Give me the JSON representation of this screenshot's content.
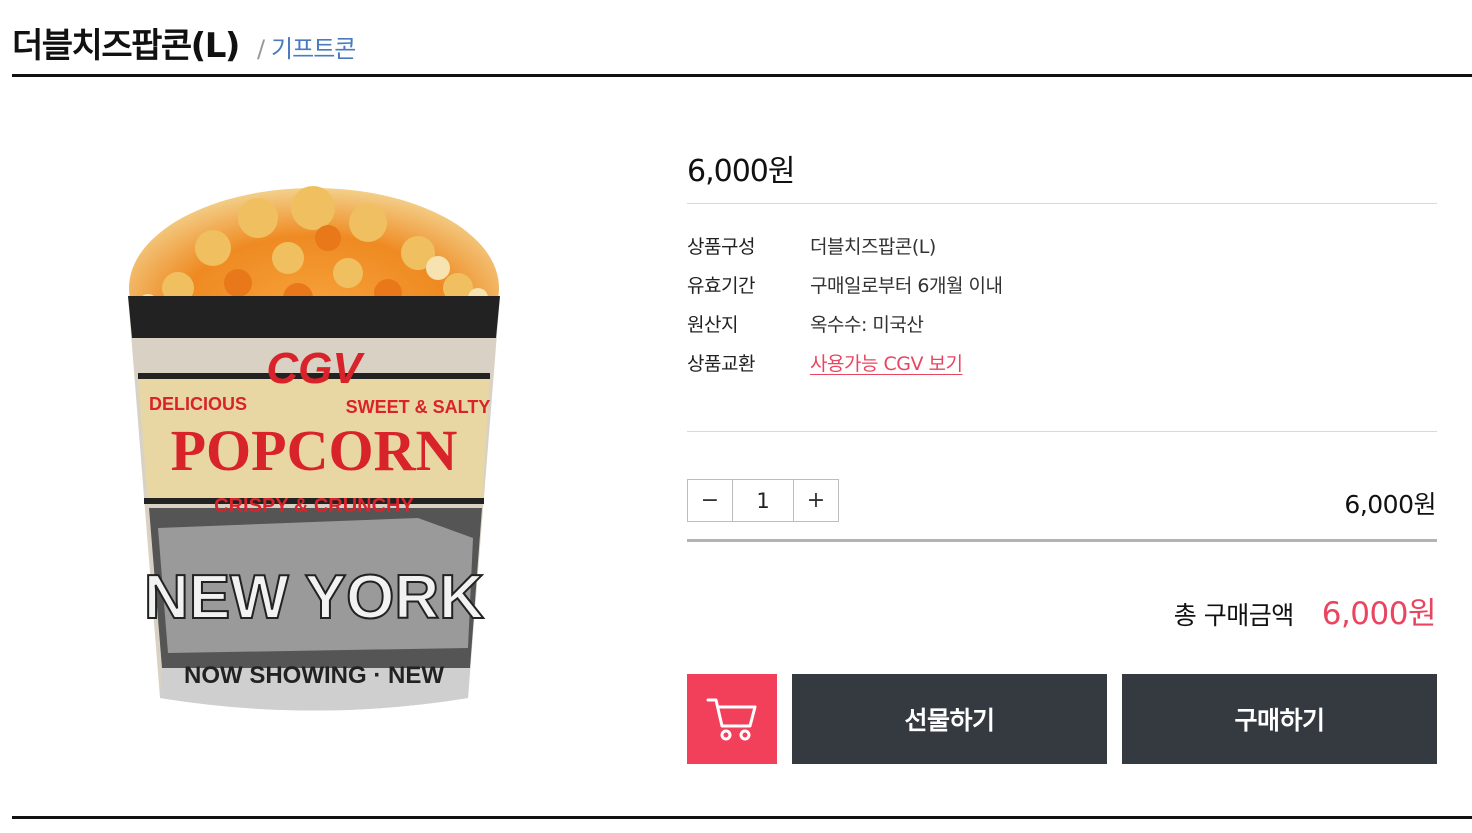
{
  "header": {
    "title": "더블치즈팝콘(L)",
    "separator": "/",
    "category": "기프트콘"
  },
  "product": {
    "price": "6,000원",
    "image_text": {
      "brand": "CGV",
      "headline": "POPCORN",
      "sub": "CRISPY & CRUNCHY",
      "left": "DELICIOUS",
      "right": "SWEET & SALTY",
      "city": "NEW YORK",
      "bottom": "NOW SHOWING · NEW"
    },
    "info": [
      {
        "label": "상품구성",
        "value": "더블치즈팝콘(L)"
      },
      {
        "label": "유효기간",
        "value": "구매일로부터 6개월 이내"
      },
      {
        "label": "원산지",
        "value": "옥수수: 미국산"
      },
      {
        "label": "상품교환",
        "value": "사용가능 CGV 보기"
      }
    ]
  },
  "quantity": {
    "minus": "−",
    "value": "1",
    "plus": "+",
    "line_price": "6,000원"
  },
  "total": {
    "label": "총 구매금액",
    "price": "6,000원"
  },
  "actions": {
    "cart_icon": "cart-icon",
    "gift_label": "선물하기",
    "buy_label": "구매하기"
  },
  "colors": {
    "accent": "#f2405b",
    "dark_button": "#353a40",
    "link": "#e94560",
    "category": "#4a7bbf"
  }
}
